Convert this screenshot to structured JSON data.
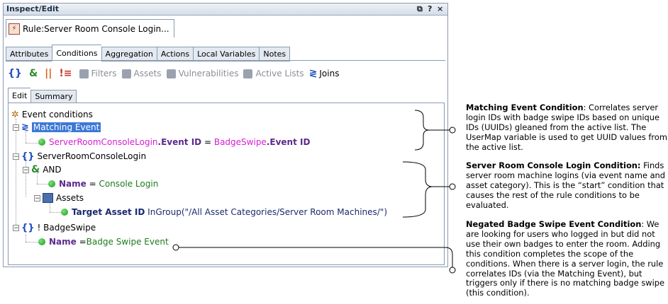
{
  "window": {
    "title": "Inspect/Edit",
    "controls": [
      "⧉",
      "?",
      "×"
    ]
  },
  "editor_tab": {
    "label": "Rule:Server Room Console Login...",
    "icon": "rule-lightning-icon"
  },
  "tabs": [
    {
      "label": "Attributes",
      "active": false
    },
    {
      "label": "Conditions",
      "active": true
    },
    {
      "label": "Aggregation",
      "active": false
    },
    {
      "label": "Actions",
      "active": false
    },
    {
      "label": "Local Variables",
      "active": false
    },
    {
      "label": "Notes",
      "active": false
    }
  ],
  "toolbar": {
    "filters": "Filters",
    "assets": "Assets",
    "vulnerabilities": "Vulnerabilities",
    "active_lists": "Active Lists",
    "joins": "Joins"
  },
  "subtabs": [
    {
      "label": "Edit",
      "active": true
    },
    {
      "label": "Summary",
      "active": false
    }
  ],
  "tree": {
    "root": "Event conditions",
    "matching_event": {
      "label": "Matching Event",
      "cond": {
        "left_obj": "ServerRoomConsoleLogin",
        "left_field": ".Event ID",
        "op": " = ",
        "right_obj": "BadgeSwipe",
        "right_field": ".Event ID"
      }
    },
    "server_room": {
      "label": "ServerRoomConsoleLogin",
      "and": "AND",
      "name_cond": {
        "field": "Name",
        "op": " = ",
        "value": "Console Login"
      },
      "assets": "Assets",
      "asset_cond": {
        "field": "Target Asset ID",
        "rest": " InGroup(\"/All Asset Categories/Server Room Machines/\")"
      }
    },
    "badge": {
      "label": "! BadgeSwipe",
      "name_cond": {
        "field": "Name",
        "op": " =",
        "value": "Badge Swipe Event"
      }
    }
  },
  "annotations": {
    "matching": {
      "title": "Matching Event Condition",
      "body": ": Correlates server login IDs with badge swipe IDs based on unique IDs (UUIDs) gleaned from the active list. The UserMap variable is used to get UUID values from the active list."
    },
    "server": {
      "title": "Server Room Console Login Condition:",
      "body": " Finds server room machine logins (via event name and asset category). This is the “start” condition that causes the rest of the rule conditions to be evaluated."
    },
    "negated": {
      "title": "Negated Badge Swipe Event Condition",
      "body": ": We are looking for users who logged in but did not use their own badges to enter the room. Adding this condition completes the scope of the conditions. When there is a server login, the rule correlates IDs (via the Matching Event), but triggers only if there is no matching badge swipe (this condition)."
    }
  },
  "colors": {
    "selection": "#3d78d6",
    "field": "#5b2a8e",
    "resource": "#d21fd2",
    "value": "#1e7a1e"
  }
}
